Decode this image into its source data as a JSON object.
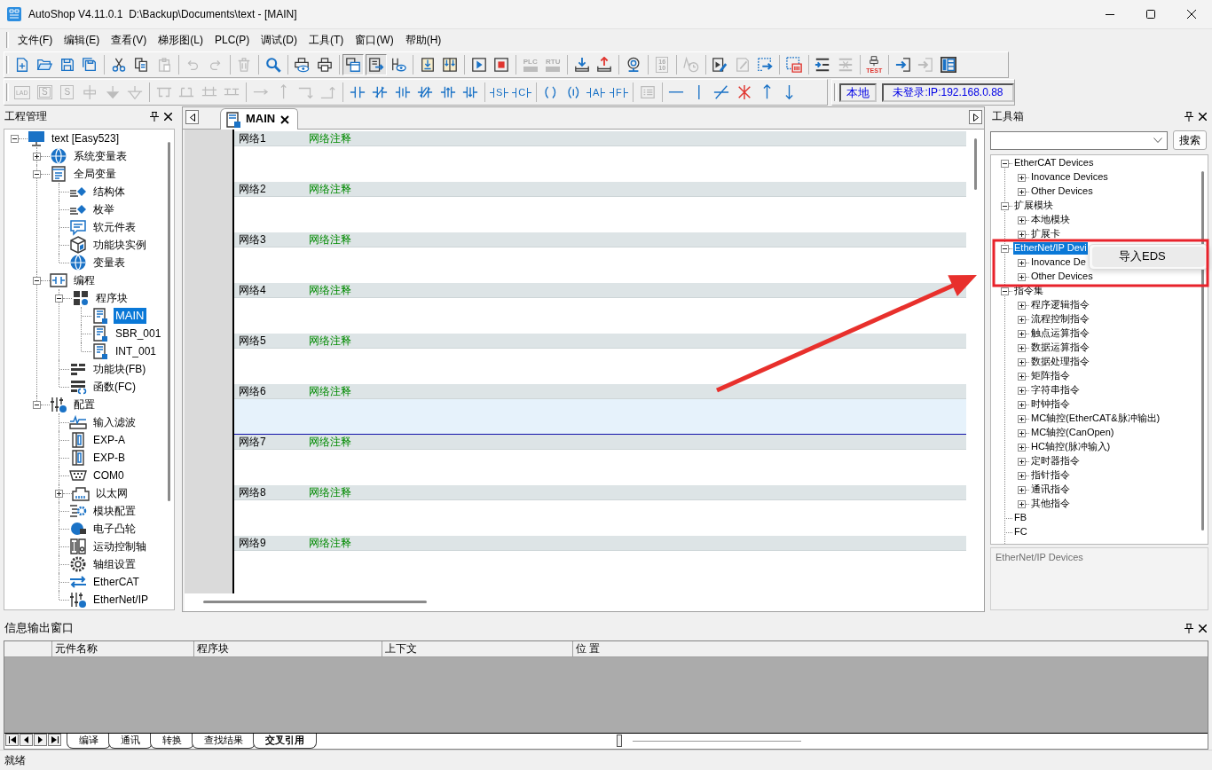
{
  "window": {
    "title": "AutoShop V4.11.0.1  D:\\Backup\\Documents\\text - [MAIN]"
  },
  "menu": [
    "文件(F)",
    "编辑(E)",
    "查看(V)",
    "梯形图(L)",
    "PLC(P)",
    "调试(D)",
    "工具(T)",
    "窗口(W)",
    "帮助(H)"
  ],
  "toolbar_1": [
    [
      {
        "disabled": false,
        "pressed": false
      },
      {
        "disabled": false,
        "pressed": false
      },
      {
        "disabled": false,
        "pressed": false
      },
      {
        "disabled": false,
        "pressed": false
      }
    ],
    [
      {
        "disabled": false,
        "pressed": false
      },
      {
        "disabled": false,
        "pressed": false
      },
      {
        "disabled": true,
        "pressed": false
      }
    ],
    [
      {
        "disabled": true,
        "pressed": false
      },
      {
        "disabled": true,
        "pressed": false
      }
    ],
    [
      {
        "disabled": true,
        "pressed": false
      }
    ],
    [
      {
        "disabled": false,
        "pressed": false
      }
    ],
    [
      {
        "disabled": false,
        "pressed": false
      },
      {
        "disabled": false,
        "pressed": false
      }
    ],
    [
      {
        "disabled": false,
        "pressed": true
      },
      {
        "disabled": false,
        "pressed": true
      },
      {
        "disabled": false,
        "pressed": false
      }
    ],
    [
      {
        "disabled": false,
        "pressed": false
      },
      {
        "disabled": false,
        "pressed": false
      }
    ],
    [
      {
        "disabled": false,
        "pressed": false
      },
      {
        "disabled": false,
        "pressed": false
      }
    ],
    [
      {
        "label": "PLC",
        "disabled": true,
        "pressed": false
      },
      {
        "label": "RTU",
        "disabled": true,
        "pressed": false
      }
    ],
    [
      {
        "disabled": false,
        "pressed": false
      },
      {
        "disabled": false,
        "pressed": false
      }
    ],
    [
      {
        "disabled": false,
        "pressed": false
      }
    ],
    [
      {
        "label": "16 10",
        "disabled": true,
        "pressed": false
      }
    ],
    [
      {
        "disabled": true,
        "pressed": false
      }
    ],
    [
      {
        "disabled": false,
        "pressed": false
      },
      {
        "disabled": true,
        "pressed": false
      },
      {
        "disabled": false,
        "pressed": false
      }
    ],
    [
      {
        "disabled": false,
        "pressed": false
      }
    ],
    [
      {
        "disabled": false,
        "pressed": false
      },
      {
        "disabled": true,
        "pressed": false
      }
    ],
    [
      {
        "label": "TEST",
        "disabled": false,
        "pressed": false
      }
    ],
    [
      {
        "disabled": false,
        "pressed": false
      },
      {
        "disabled": true,
        "pressed": false
      },
      {
        "disabled": false,
        "pressed": false
      }
    ]
  ],
  "toolbar_2": [
    [
      {
        "label": "LAD",
        "disabled": true
      },
      {
        "label": "S",
        "disabled": true
      },
      {
        "label": "S",
        "disabled": true
      },
      {
        "disabled": true
      },
      {
        "disabled": true
      },
      {
        "disabled": true
      }
    ],
    [
      {
        "disabled": true
      },
      {
        "disabled": true
      },
      {
        "disabled": true
      },
      {
        "disabled": true
      }
    ],
    [
      {
        "disabled": true
      },
      {
        "disabled": true
      },
      {
        "disabled": true
      },
      {
        "disabled": true
      }
    ],
    [
      {
        "disabled": false
      },
      {
        "disabled": false
      },
      {
        "disabled": false
      },
      {
        "disabled": false
      },
      {
        "disabled": false
      },
      {
        "disabled": false
      }
    ],
    [
      {
        "label": "S",
        "disabled": false
      },
      {
        "label": "C",
        "disabled": false
      }
    ],
    [
      {
        "disabled": false
      },
      {
        "disabled": false
      },
      {
        "label": "A",
        "disabled": false
      },
      {
        "label": "F",
        "disabled": false
      }
    ],
    [
      {
        "disabled": true
      }
    ],
    [
      {
        "disabled": false
      },
      {
        "disabled": false
      },
      {
        "disabled": false
      },
      {
        "disabled": false
      },
      {
        "disabled": false
      },
      {
        "disabled": false
      }
    ]
  ],
  "connection": {
    "mode": "本地",
    "status": "未登录:IP:192.168.0.88"
  },
  "project_panel": {
    "title": "工程管理",
    "tree": [
      {
        "label": "text [Easy523]",
        "expanded": true,
        "selected": false,
        "children": [
          {
            "label": "系统变量表",
            "expanded": false,
            "selected": false
          },
          {
            "label": "全局变量",
            "expanded": true,
            "selected": false,
            "children": [
              {
                "label": "结构体",
                "selected": false
              },
              {
                "label": "枚举",
                "selected": false
              },
              {
                "label": "软元件表",
                "selected": false
              },
              {
                "label": "功能块实例",
                "selected": false
              },
              {
                "label": "变量表",
                "selected": false
              }
            ]
          },
          {
            "label": "编程",
            "expanded": true,
            "selected": false,
            "children": [
              {
                "label": "程序块",
                "expanded": true,
                "selected": false,
                "children": [
                  {
                    "label": "MAIN",
                    "selected": true
                  },
                  {
                    "label": "SBR_001",
                    "selected": false
                  },
                  {
                    "label": "INT_001",
                    "selected": false
                  }
                ]
              },
              {
                "label": "功能块(FB)",
                "selected": false
              },
              {
                "label": "函数(FC)",
                "selected": false
              }
            ]
          },
          {
            "label": "配置",
            "expanded": true,
            "selected": false,
            "children": [
              {
                "label": "输入滤波",
                "selected": false
              },
              {
                "label": "EXP-A",
                "selected": false
              },
              {
                "label": "EXP-B",
                "selected": false
              },
              {
                "label": "COM0",
                "selected": false
              },
              {
                "label": "以太网",
                "expanded": false,
                "selected": false
              },
              {
                "label": "模块配置",
                "selected": false
              },
              {
                "label": "电子凸轮",
                "selected": false
              },
              {
                "label": "运动控制轴",
                "selected": false
              },
              {
                "label": "轴组设置",
                "selected": false
              },
              {
                "label": "EtherCAT",
                "selected": false
              },
              {
                "label": "EtherNet/IP",
                "selected": false
              }
            ]
          }
        ]
      }
    ]
  },
  "editor": {
    "tabs": [
      {
        "label": "MAIN",
        "selected": true
      }
    ],
    "networks": [
      {
        "label": "网络1",
        "comment": "网络注释",
        "selected": false
      },
      {
        "label": "网络2",
        "comment": "网络注释",
        "selected": false
      },
      {
        "label": "网络3",
        "comment": "网络注释",
        "selected": false
      },
      {
        "label": "网络4",
        "comment": "网络注释",
        "selected": false
      },
      {
        "label": "网络5",
        "comment": "网络注释",
        "selected": false
      },
      {
        "label": "网络6",
        "comment": "网络注释",
        "selected": true
      },
      {
        "label": "网络7",
        "comment": "网络注释",
        "selected": false
      },
      {
        "label": "网络8",
        "comment": "网络注释",
        "selected": false
      },
      {
        "label": "网络9",
        "comment": "网络注释",
        "selected": false
      }
    ]
  },
  "toolbox": {
    "title": "工具箱",
    "search_button": "搜索",
    "tree": [
      {
        "label": "EtherCAT Devices",
        "expanded": true,
        "selected": false,
        "children": [
          {
            "label": "Inovance Devices",
            "expanded": false,
            "selected": false
          },
          {
            "label": "Other Devices",
            "expanded": false,
            "selected": false
          }
        ]
      },
      {
        "label": "扩展模块",
        "expanded": true,
        "selected": false,
        "children": [
          {
            "label": "本地模块",
            "expanded": false,
            "selected": false
          },
          {
            "label": "扩展卡",
            "expanded": false,
            "selected": false
          }
        ]
      },
      {
        "label": "EtherNet/IP Devi",
        "expanded": true,
        "selected": true,
        "children": [
          {
            "label": "Inovance De",
            "expanded": false,
            "selected": false
          },
          {
            "label": "Other Devices",
            "expanded": false,
            "selected": false
          }
        ]
      },
      {
        "label": "指令集",
        "expanded": true,
        "selected": false,
        "children": [
          {
            "label": "程序逻辑指令",
            "expanded": false,
            "selected": false
          },
          {
            "label": "流程控制指令",
            "expanded": false,
            "selected": false
          },
          {
            "label": "触点运算指令",
            "expanded": false,
            "selected": false
          },
          {
            "label": "数据运算指令",
            "expanded": false,
            "selected": false
          },
          {
            "label": "数据处理指令",
            "expanded": false,
            "selected": false
          },
          {
            "label": "矩阵指令",
            "expanded": false,
            "selected": false
          },
          {
            "label": "字符串指令",
            "expanded": false,
            "selected": false
          },
          {
            "label": "时钟指令",
            "expanded": false,
            "selected": false
          },
          {
            "label": "MC轴控(EtherCAT&脉冲输出)",
            "expanded": false,
            "selected": false
          },
          {
            "label": "MC轴控(CanOpen)",
            "expanded": false,
            "selected": false
          },
          {
            "label": "HC轴控(脉冲输入)",
            "expanded": false,
            "selected": false
          },
          {
            "label": "定时器指令",
            "expanded": false,
            "selected": false
          },
          {
            "label": "指针指令",
            "expanded": false,
            "selected": false
          },
          {
            "label": "通讯指令",
            "expanded": false,
            "selected": false
          },
          {
            "label": "其他指令",
            "expanded": false,
            "selected": false
          }
        ]
      },
      {
        "label": "FB",
        "selected": false
      },
      {
        "label": "FC",
        "selected": false
      }
    ],
    "description": "EtherNet/IP Devices"
  },
  "context_menu": {
    "items": [
      {
        "label": "导入EDS",
        "hovered": true
      }
    ]
  },
  "output_panel": {
    "title": "信息输出窗口",
    "columns": [
      "元件名称",
      "程序块",
      "上下文",
      "位 置"
    ],
    "tabs": [
      {
        "label": "编译",
        "selected": false
      },
      {
        "label": "通讯",
        "selected": false
      },
      {
        "label": "转换",
        "selected": false
      },
      {
        "label": "查找结果",
        "selected": false
      },
      {
        "label": "交叉引用",
        "selected": true
      }
    ]
  },
  "status_bar": {
    "text": "就绪"
  }
}
